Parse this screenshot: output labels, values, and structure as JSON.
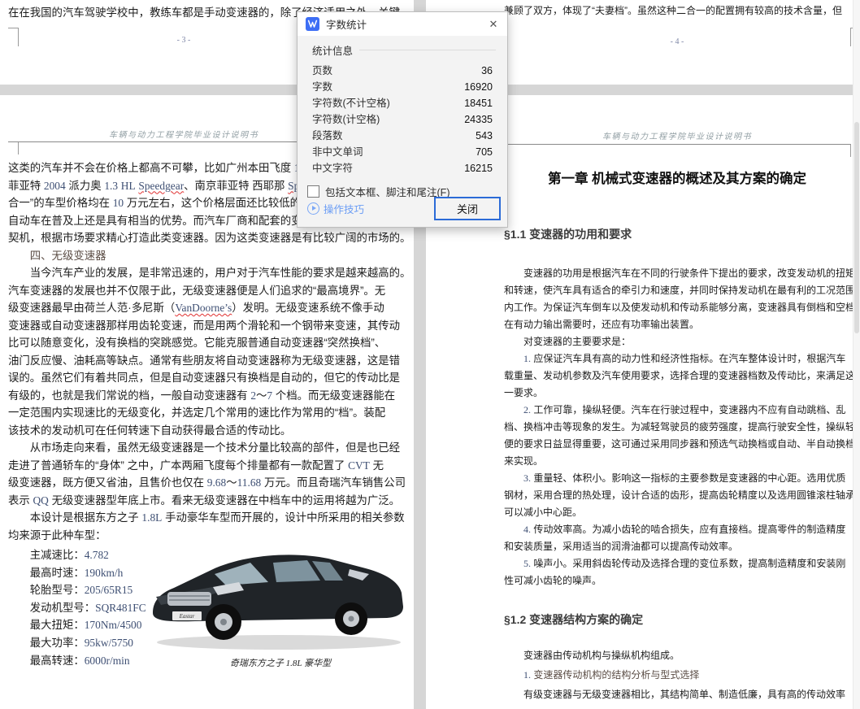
{
  "dialog": {
    "title": "字数统计",
    "close_icon": "✕",
    "section_label": "统计信息",
    "rows": [
      {
        "label": "页数",
        "value": "36"
      },
      {
        "label": "字数",
        "value": "16920"
      },
      {
        "label": "字符数(不计空格)",
        "value": "18451"
      },
      {
        "label": "字符数(计空格)",
        "value": "24335"
      },
      {
        "label": "段落数",
        "value": "543"
      },
      {
        "label": "非中文单词",
        "value": "705"
      },
      {
        "label": "中文字符",
        "value": "16215"
      }
    ],
    "checkbox": {
      "checked": false,
      "label_pre": "包括文本框、脚注和尾注(",
      "label_key": "F",
      "label_post": ")"
    },
    "tips_label": "操作技巧",
    "close_button_label": "关闭",
    "accent_color": "#2b6bd7",
    "link_color": "#6b9df5"
  },
  "spellcheck_words": [
    "Speedgear",
    "Speedg",
    "VanDoorne’s"
  ],
  "left_page": {
    "tail_line": "在在我国的汽车驾驶学校中，教练车都是手动变速器的，除了经济适用之外，关键",
    "page_number": "- 3 -",
    "header": "车辆与动力工程学院毕业设计说明书",
    "body_lines": [
      "这类的汽车并不会在价格上都高不可攀，比如广州本田飞度 1.3L C",
      "菲亚特 2004 派力奥 1.3 HL Speedgear、南京菲亚特 西耶那 Speedg",
      "合一”的车型价格均在 10 万元左右，这个价格层面还比较低的。",
      "自动车在普及上还是具有相当的优势。而汽车厂商和配套的变速器",
      "契机，根据市场要求精心打造此类变速器。因为这类变速器是有比较广阔的市场的。",
      {
        "text": "　　四、无级变速器",
        "style": "subhead"
      },
      "　　当今汽车产业的发展，是非常迅速的，用户对于汽车性能的要求是越来越高的。",
      "汽车变速器的发展也并不仅限于此，无级变速器便是人们追求的“最高境界”。无",
      "级变速器最早由荷兰人范·多尼斯（VanDoorne’s）发明。无级变速系统不像手动",
      "变速器或自动变速器那样用齿轮变速，而是用两个滑轮和一个钢带来变速，其传动",
      "比可以随意变化，没有换档的突跳感觉。它能克服普通自动变速器“突然换档”、",
      "油门反应慢、油耗高等缺点。通常有些朋友将自动变速器称为无级变速器，这是错",
      "误的。虽然它们有着共同点，但是自动变速器只有换档是自动的，但它的传动比是",
      "有级的，也就是我们常说的档，一般自动变速器有 2～7 个档。而无级变速器能在",
      "一定范围内实现速比的无级变化，并选定几个常用的速比作为常用的“档”。装配",
      "该技术的发动机可在任何转速下自动获得最合适的传动比。",
      "　　从市场走向来看，虽然无级变速器是一个技术分量比较高的部件，但是也已经",
      "走进了普通轿车的“身体” 之中，广本两厢飞度每个排量都有一款配置了 CVT 无",
      "级变速器，既方便又省油，且售价也仅在 9.68～11.68 万元。而且奇瑞汽车销售公司",
      "表示 QQ 无级变速器型年底上市。看来无级变速器在中档车中的运用将越为广泛。",
      "　　本设计是根据东方之子 1.8L 手动豪华车型而开展的，设计中所采用的相关参数",
      "均来源于此种车型："
    ],
    "specs": [
      {
        "label": "主减速比",
        "value": "4.782"
      },
      {
        "label": "最高时速",
        "value": "190km/h"
      },
      {
        "label": "轮胎型号",
        "value": "205/65R15"
      },
      {
        "label": "发动机型号",
        "value": "SQR481FC"
      },
      {
        "label": "最大扭矩",
        "value": "170Nm/4500"
      },
      {
        "label": "最大功率",
        "value": "95kw/5750"
      },
      {
        "label": "最高转速",
        "value": "6000r/min"
      }
    ],
    "car_caption": "奇瑞东方之子 1.8L 豪华型"
  },
  "right_page": {
    "tail_line": "兼顾了双方，体现了“夫妻档”。虽然这种二合一的配置拥有较高的技术含量，但",
    "page_number": "- 4 -",
    "header": "车辆与动力工程学院毕业设计说明书",
    "chapter_title": "第一章 机械式变速器的概述及其方案的确定",
    "section1_title": "§1.1 变速器的功用和要求",
    "body_lines": [
      "　　变速器的功用是根据汽车在不同的行驶条件下提出的要求，改变发动机的扭矩",
      "和转速，使汽车具有适合的牵引力和速度，并同时保持发动机在最有利的工况范围",
      "内工作。为保证汽车倒车以及使发动机和传动系能够分离，变速器具有倒档和空档。",
      "在有动力输出需要时，还应有功率输出装置。",
      "　　对变速器的主要要求是：",
      "　　1. 应保证汽车具有高的动力性和经济性指标。在汽车整体设计时，根据汽车",
      "载重量、发动机参数及汽车使用要求，选择合理的变速器档数及传动比，来满足这",
      "一要求。",
      "　　2. 工作可靠，操纵轻便。汽车在行驶过程中，变速器内不应有自动跳档、乱",
      "档、换档冲击等现象的发生。为减轻驾驶员的疲劳强度，提高行驶安全性，操纵轻",
      "便的要求日益显得重要，这可通过采用同步器和预选气动换档或自动、半自动换档",
      "来实现。",
      "　　3. 重量轻、体积小。影响这一指标的主要参数是变速器的中心距。选用优质",
      "钢材，采用合理的热处理，设计合适的齿形，提高齿轮精度以及选用圆锥滚柱轴承",
      "可以减小中心距。",
      "　　4. 传动效率高。为减小齿轮的啮合损失，应有直接档。提高零件的制造精度",
      "和安装质量，采用适当的润滑油都可以提高传动效率。",
      "　　5. 噪声小。采用斜齿轮传动及选择合理的变位系数，提高制造精度和安装刚",
      "性可减小齿轮的噪声。"
    ],
    "section2_title": "§1.2 变速器结构方案的确定",
    "body2_lines": [
      "　　变速器由传动机构与操纵机构组成。",
      {
        "text": "　　1. 变速器传动机构的结构分析与型式选择",
        "style": "subhead"
      },
      "　　有级变速器与无级变速器相比，其结构简单、制造低廉，具有高的传动效率"
    ]
  }
}
